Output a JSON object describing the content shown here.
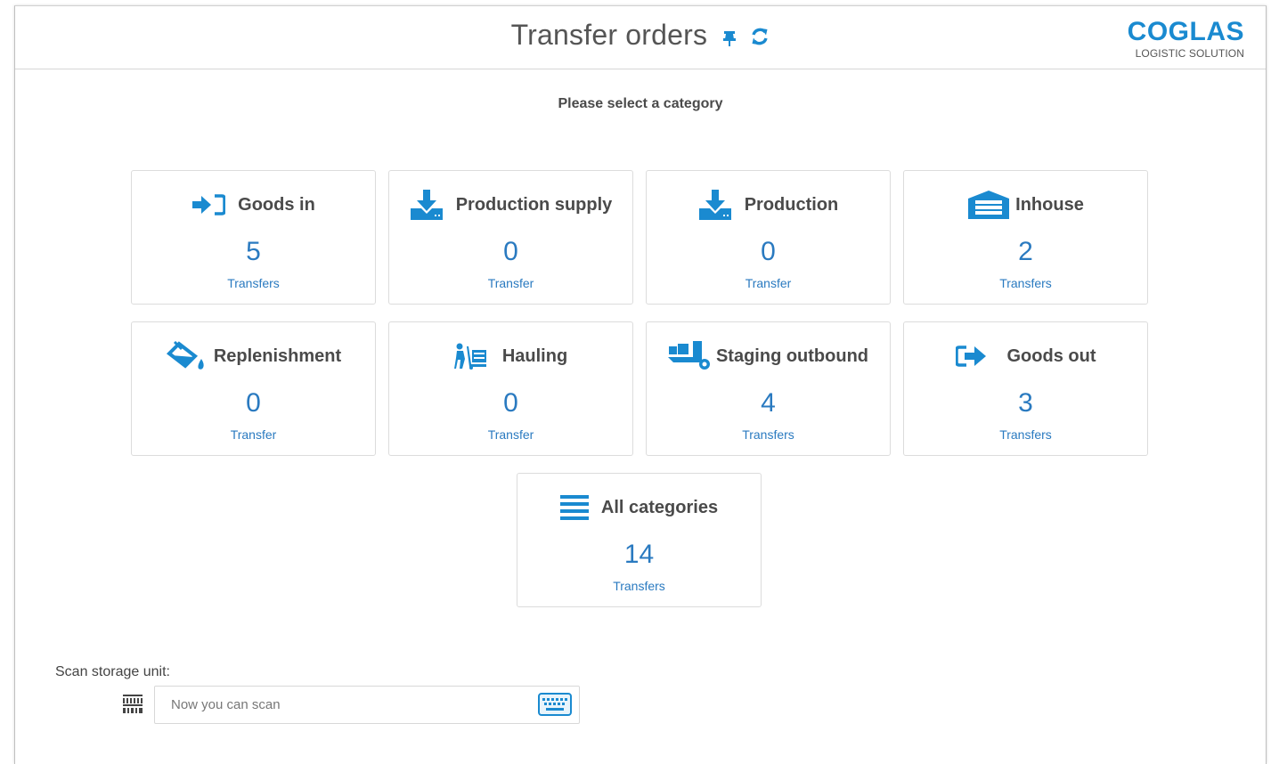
{
  "header": {
    "title": "Transfer orders",
    "logo_brand": "COGLAS",
    "logo_tagline": "LOGISTIC SOLUTION"
  },
  "prompt": "Please select a category",
  "accent_color": "#1a8ad0",
  "count_color": "#2a7ac0",
  "categories": [
    {
      "label": "Goods in",
      "count": "5",
      "unit": "Transfers",
      "icon": "sign-in-icon"
    },
    {
      "label": "Production supply",
      "count": "0",
      "unit": "Transfer",
      "icon": "download-tray-icon"
    },
    {
      "label": "Production",
      "count": "0",
      "unit": "Transfer",
      "icon": "download-tray-icon"
    },
    {
      "label": "Inhouse",
      "count": "2",
      "unit": "Transfers",
      "icon": "warehouse-icon"
    },
    {
      "label": "Replenishment",
      "count": "0",
      "unit": "Transfer",
      "icon": "fill-drip-icon"
    },
    {
      "label": "Hauling",
      "count": "0",
      "unit": "Transfer",
      "icon": "dolly-icon"
    },
    {
      "label": "Staging outbound",
      "count": "4",
      "unit": "Transfers",
      "icon": "truck-loading-icon"
    },
    {
      "label": "Goods out",
      "count": "3",
      "unit": "Transfers",
      "icon": "sign-out-icon"
    },
    {
      "label": "All categories",
      "count": "14",
      "unit": "Transfers",
      "icon": "list-icon"
    }
  ],
  "scan": {
    "label": "Scan storage unit:",
    "placeholder": "Now you can scan",
    "value": ""
  }
}
